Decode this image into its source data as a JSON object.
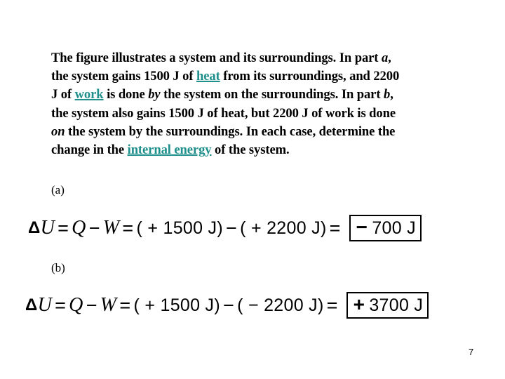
{
  "problem": {
    "lines": [
      [
        "The figure illustrates a system and its surroundings. In part ",
        {
          "i": "a"
        },
        ","
      ],
      [
        "the system gains 1500 J of ",
        {
          "link": "heat"
        },
        " from its surroundings, and 2200"
      ],
      [
        "J of ",
        {
          "link": "work"
        },
        " is done ",
        {
          "i": "by"
        },
        " the system on the surroundings. In part ",
        {
          "i": "b"
        },
        ","
      ],
      [
        "the system also gains 1500 J of heat, but 2200 J of work is done"
      ],
      [
        {
          "i": "on"
        },
        " the system by the surroundings. In each case, determine the"
      ],
      [
        "change in the ",
        {
          "link": "internal energy"
        },
        " of the system."
      ]
    ],
    "link_color": "#1f8f8c"
  },
  "part_a": {
    "label": "(a)",
    "delta": "Δ",
    "U": "U",
    "eq1": "=",
    "Q": "Q",
    "minus1": "−",
    "W": "W",
    "eq2": "=",
    "term1": "( + 1500 J)",
    "minus2": "−",
    "term2": "( + 2200 J)",
    "eq3": "=",
    "answer_sign": "−",
    "answer_value": "700 J"
  },
  "part_b": {
    "label": "(b)",
    "delta": "Δ",
    "U": "U",
    "eq1": "=",
    "Q": "Q",
    "minus1": "−",
    "W": "W",
    "eq2": "=",
    "term1": "( + 1500 J)",
    "minus2": "−",
    "term2": "( − 2200 J)",
    "eq3": "=",
    "answer_sign": "+",
    "answer_value": "3700 J"
  },
  "page_number": "7"
}
